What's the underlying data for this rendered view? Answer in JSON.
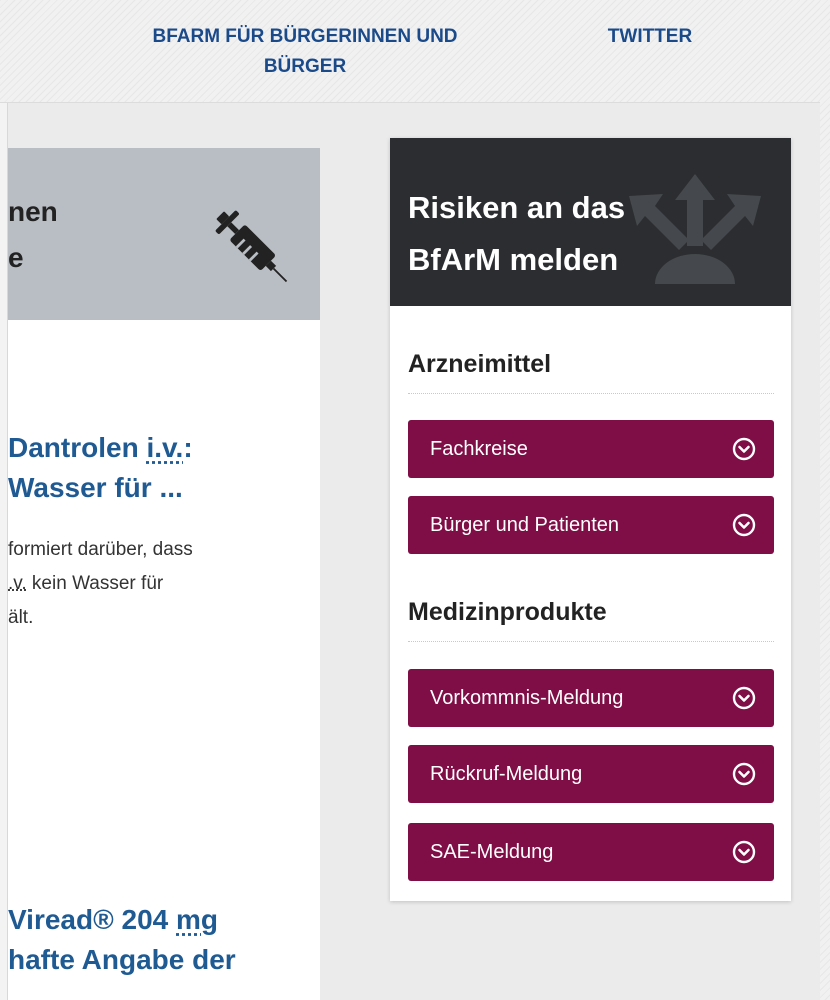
{
  "topnav": {
    "buerger_label": "BFARM FÜR BÜRGERINNEN UND BÜRGER",
    "twitter_label": "TWITTER",
    "link_color": "#1b4a8a"
  },
  "left_panel": {
    "heading_line1": "nen",
    "heading_line2": "e",
    "icon": "syringe-icon",
    "articles": [
      {
        "title_line1_pre": "Dantrolen ",
        "title_line1_abbr": "i.v.",
        "title_line1_post": ":",
        "title_line2": "Wasser für ...",
        "text_line1": "formiert darüber, dass",
        "text_line2_abbr": ".v.",
        "text_line2_post": " kein Wasser für",
        "text_line3": "ält."
      },
      {
        "title_line1_pre": "Viread® 204 ",
        "title_line1_abbr": "mg",
        "title_line2": "hafte Angabe der"
      }
    ]
  },
  "report_box": {
    "title": "Risiken an das BfArM melden",
    "header_icon": "report-arrows-icon",
    "sections": [
      {
        "title": "Arzneimittel",
        "buttons": [
          "Fachkreise",
          "Bürger und Patienten"
        ]
      },
      {
        "title": "Medizinprodukte",
        "buttons": [
          "Vorkommnis-Meldung",
          "Rückruf-Meldung",
          "SAE-Meldung"
        ]
      }
    ],
    "button_icon": "chevron-down-circle-icon",
    "button_color": "#7f0d46",
    "header_color": "#2b2d30"
  }
}
